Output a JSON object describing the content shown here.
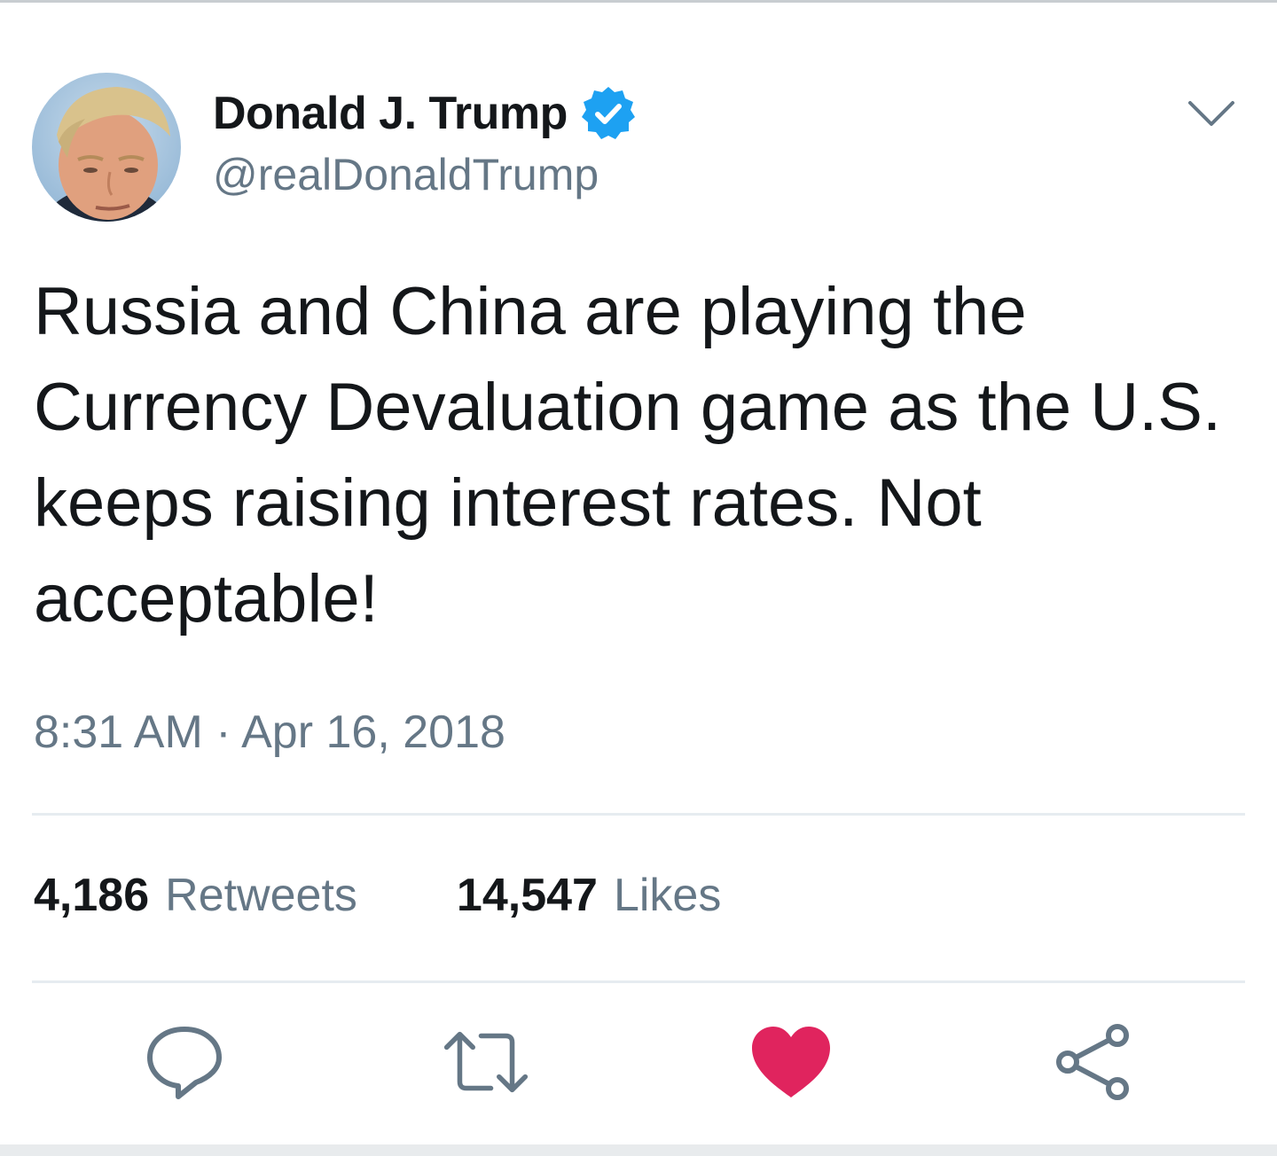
{
  "tweet": {
    "display_name": "Donald J. Trump",
    "handle": "@realDonaldTrump",
    "verified": true,
    "text": "Russia and China are playing the Currency Devaluation game as the U.S. keeps raising interest rates. Not acceptable!",
    "timestamp": "8:31 AM · Apr 16, 2018"
  },
  "stats": {
    "retweets_count": "4,186",
    "retweets_label": "Retweets",
    "likes_count": "14,547",
    "likes_label": "Likes"
  },
  "actions": {
    "reply_icon": "reply-icon",
    "retweet_icon": "retweet-icon",
    "like_icon": "heart-icon",
    "share_icon": "share-icon",
    "liked": true
  },
  "colors": {
    "verified_blue": "#1da1f2",
    "like_red": "#e0245e",
    "secondary_text": "#657786",
    "primary_text": "#14171a",
    "icon_gray": "#657786"
  }
}
